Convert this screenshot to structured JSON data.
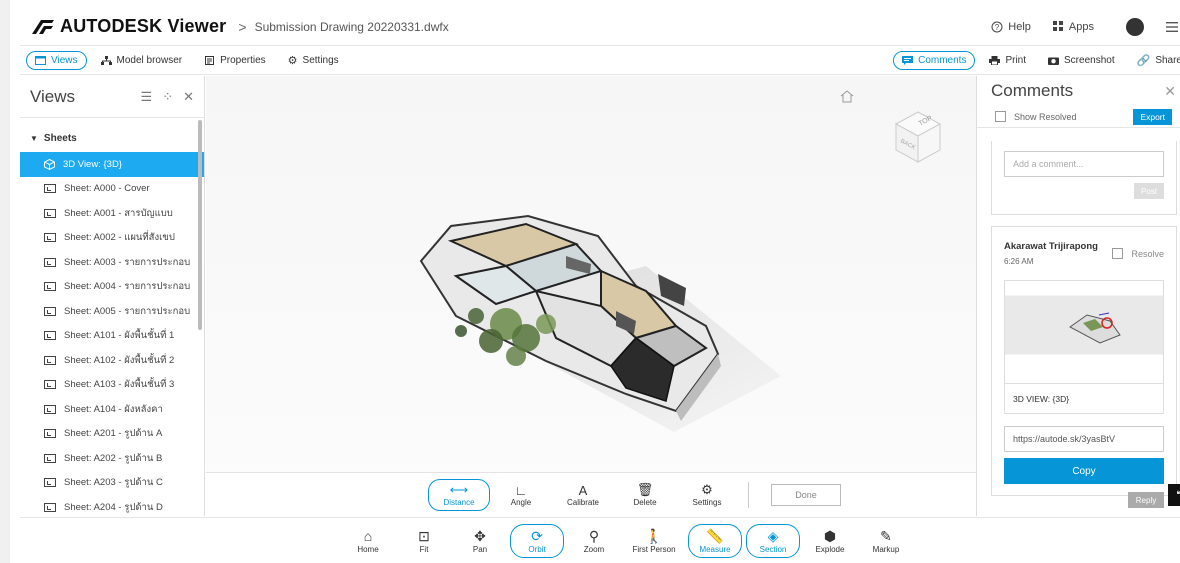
{
  "header": {
    "brand": "AUTODESK Viewer",
    "separator": ">",
    "file_name": "Submission Drawing 20220331.dwfx",
    "help_label": "Help",
    "apps_label": "Apps"
  },
  "toolbar": {
    "views": "Views",
    "model_browser": "Model browser",
    "properties": "Properties",
    "settings": "Settings",
    "comments": "Comments",
    "print": "Print",
    "screenshot": "Screenshot",
    "share": "Share"
  },
  "views_panel": {
    "title": "Views",
    "section": "Sheets",
    "items": [
      {
        "label": "3D View: {3D}"
      },
      {
        "label": "Sheet: A000 - Cover"
      },
      {
        "label": "Sheet: A001 - สารบัญแบบ"
      },
      {
        "label": "Sheet: A002 - แผนที่สังเขป"
      },
      {
        "label": "Sheet: A003 - รายการประกอบ"
      },
      {
        "label": "Sheet: A004 - รายการประกอบ"
      },
      {
        "label": "Sheet: A005 - รายการประกอบ"
      },
      {
        "label": "Sheet: A101 - ผังพื้นชั้นที่ 1"
      },
      {
        "label": "Sheet: A102 - ผังพื้นชั้นที่ 2"
      },
      {
        "label": "Sheet: A103 - ผังพื้นชั้นที่ 3"
      },
      {
        "label": "Sheet: A104 - ผังหลังคา"
      },
      {
        "label": "Sheet: A201 - รูปด้าน A"
      },
      {
        "label": "Sheet: A202 - รูปด้าน B"
      },
      {
        "label": "Sheet: A203 - รูปด้าน C"
      },
      {
        "label": "Sheet: A204 - รูปด้าน D"
      }
    ]
  },
  "viewcube": {
    "top": "TOP",
    "back": "BACK"
  },
  "measure_tools": {
    "distance": "Distance",
    "angle": "Angle",
    "calibrate": "Calibrate",
    "delete": "Delete",
    "settings": "Settings",
    "done": "Done"
  },
  "comments_panel": {
    "title": "Comments",
    "show_resolved": "Show Resolved",
    "export": "Export",
    "add_placeholder": "Add a comment...",
    "post": "Post",
    "author": "Akarawat Trijirapong",
    "resolve": "Resolve",
    "time": "6:26 AM",
    "view_caption": "3D VIEW: {3D}",
    "link": "https://autode.sk/3yasBtV",
    "copy": "Copy",
    "reply": "Reply"
  },
  "bottom_nav": {
    "home": "Home",
    "fit": "Fit",
    "pan": "Pan",
    "orbit": "Orbit",
    "zoom": "Zoom",
    "first_person": "First Person",
    "measure": "Measure",
    "section": "Section",
    "explode": "Explode",
    "markup": "Markup"
  },
  "colors": {
    "accent": "#0696d7",
    "selection": "#1eaaf1"
  }
}
